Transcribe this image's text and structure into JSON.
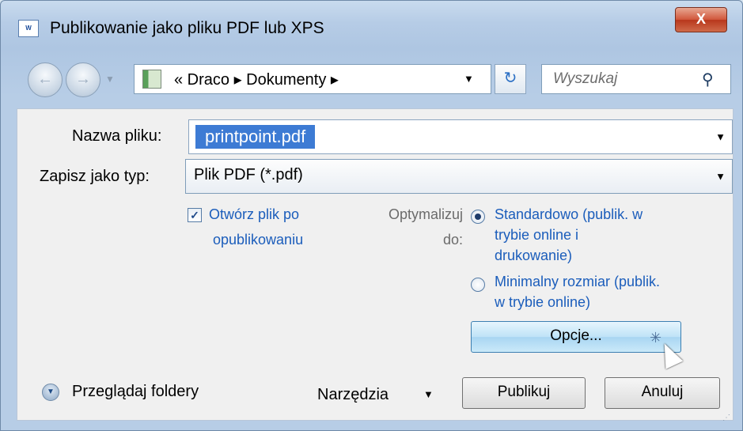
{
  "window": {
    "title": "Publikowanie jako pliku PDF lub XPS",
    "app_icon_text": "W",
    "close_symbol": "X"
  },
  "nav": {
    "back_symbol": "←",
    "forward_symbol": "→",
    "address": "« Draco ▸ Dokumenty ▸",
    "search_placeholder": "Wyszukaj"
  },
  "form": {
    "filename_label": "Nazwa pliku:",
    "filename_value": "printpoint.pdf",
    "type_label": "Zapisz jako typ:",
    "type_value": "Plik PDF (*.pdf)",
    "open_after_label_line1": "Otwórz plik po",
    "open_after_label_line2": "opublikowaniu",
    "open_after_checked": true,
    "optimize_label_line1": "Optymalizuj",
    "optimize_label_line2": "do:",
    "radio_standard_line1": "Standardowo (publik. w",
    "radio_standard_line2": "trybie online i",
    "radio_standard_line3": "drukowanie)",
    "radio_minimal_line1": "Minimalny rozmiar (publik.",
    "radio_minimal_line2": "w trybie online)",
    "selected_option": "standard",
    "options_button": "Opcje..."
  },
  "footer": {
    "browse_folders": "Przeglądaj foldery",
    "tools": "Narzędzia",
    "publish": "Publikuj",
    "cancel": "Anuluj"
  },
  "icons": {
    "dropdown": "▼",
    "check": "✓",
    "refresh": "↻",
    "search": "⚲",
    "expand": "▼"
  }
}
